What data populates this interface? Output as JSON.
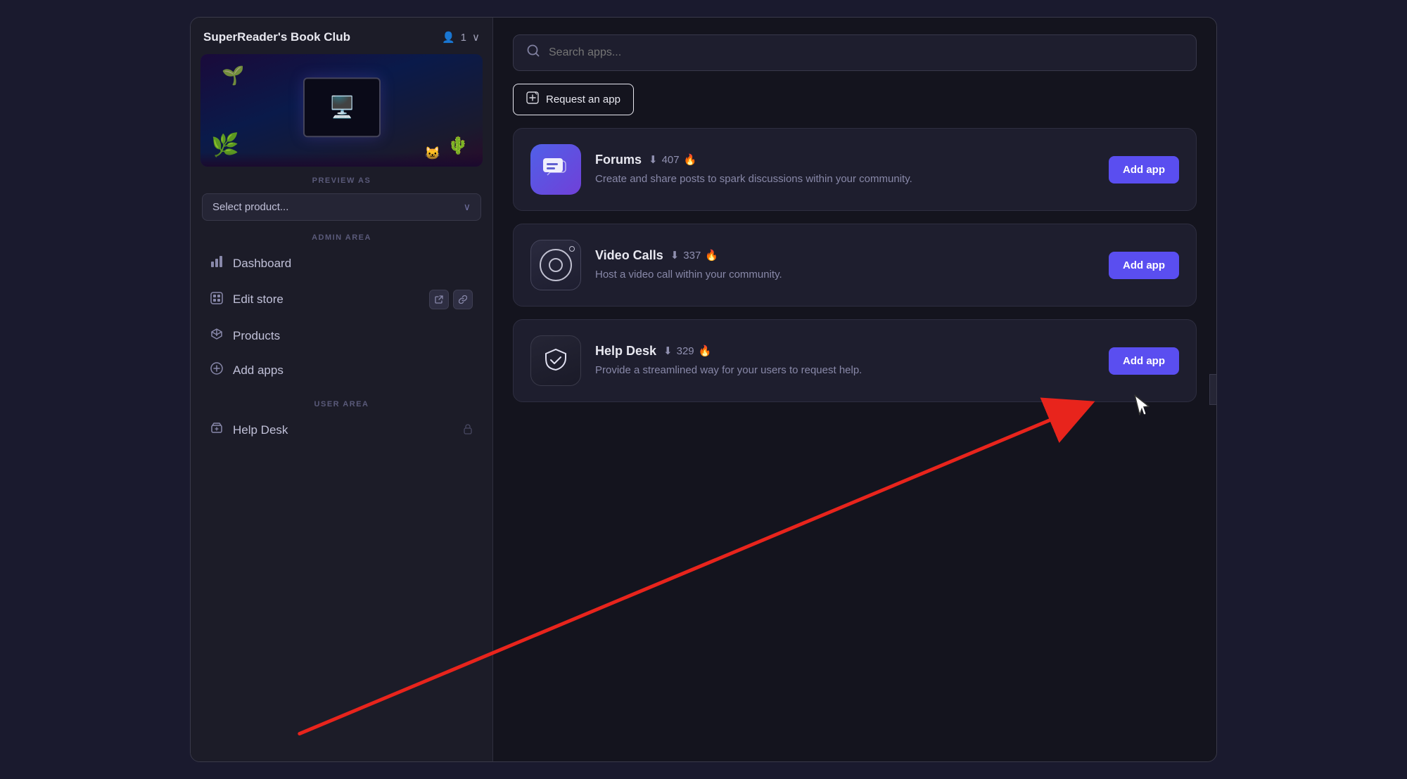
{
  "sidebar": {
    "store_name": "SuperReader's Book Club",
    "member_count": "1",
    "preview_label": "PREVIEW AS",
    "preview_placeholder": "Select product...",
    "admin_area_label": "ADMIN AREA",
    "user_area_label": "USER AREA",
    "nav_items": [
      {
        "id": "dashboard",
        "label": "Dashboard",
        "icon": "bar-chart"
      },
      {
        "id": "edit-store",
        "label": "Edit store",
        "icon": "grid",
        "actions": [
          "external-link",
          "chain-link"
        ]
      },
      {
        "id": "products",
        "label": "Products",
        "icon": "cube"
      },
      {
        "id": "add-apps",
        "label": "Add apps",
        "icon": "plus-circle"
      }
    ],
    "user_nav_items": [
      {
        "id": "help-desk",
        "label": "Help Desk",
        "icon": "ticket",
        "has_lock": true
      }
    ],
    "collapse_icon": "‹"
  },
  "main": {
    "search_placeholder": "Search apps...",
    "request_btn_label": "Request an app",
    "apps": [
      {
        "id": "forums",
        "name": "Forums",
        "downloads": "407",
        "hot": true,
        "description": "Create and share posts to spark discussions within your community.",
        "add_label": "Add app",
        "icon_type": "forums"
      },
      {
        "id": "video-calls",
        "name": "Video Calls",
        "downloads": "337",
        "hot": true,
        "description": "Host a video call within your community.",
        "add_label": "Add app",
        "icon_type": "videocalls"
      },
      {
        "id": "help-desk",
        "name": "Help Desk",
        "downloads": "329",
        "hot": true,
        "description": "Provide a streamlined way for your users to request help.",
        "add_label": "Add app",
        "icon_type": "helpdesk"
      }
    ]
  },
  "icons": {
    "search": "⌕",
    "person": "👤",
    "chevron_down": "∨",
    "chevron_left": "‹",
    "bar_chart": "📊",
    "grid": "⊞",
    "cube": "⬡",
    "plus_circle": "⊕",
    "ticket": "✦",
    "external_link": "↗",
    "chain_link": "🔗",
    "lock": "🔒",
    "fire": "🔥",
    "download": "⬇",
    "request_icon": "✦"
  }
}
